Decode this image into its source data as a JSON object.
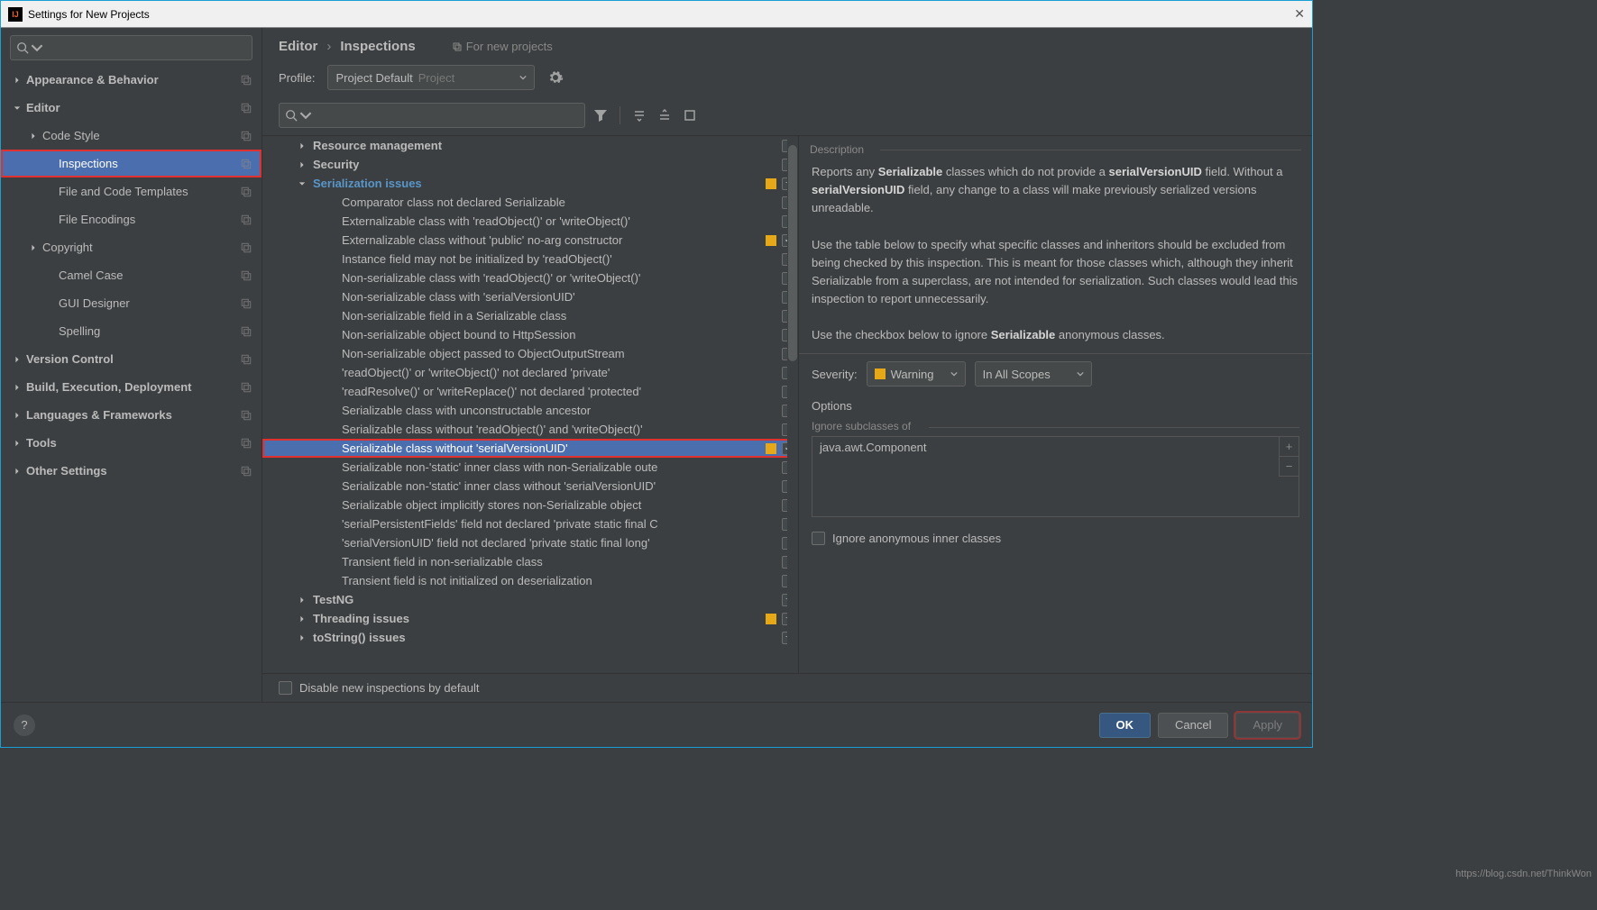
{
  "window": {
    "title": "Settings for New Projects"
  },
  "breadcrumb": {
    "a": "Editor",
    "b": "Inspections",
    "tag": "For new projects"
  },
  "profile": {
    "label": "Profile:",
    "value": "Project Default",
    "scope": "Project"
  },
  "sidebar": {
    "items": [
      {
        "label": "Appearance & Behavior",
        "arrow": "right",
        "indent": 0,
        "bold": true
      },
      {
        "label": "Editor",
        "arrow": "down",
        "indent": 0,
        "bold": true
      },
      {
        "label": "Code Style",
        "arrow": "right",
        "indent": 1,
        "bold": false
      },
      {
        "label": "Inspections",
        "arrow": "",
        "indent": 2,
        "bold": false,
        "selected": true,
        "highlight": true
      },
      {
        "label": "File and Code Templates",
        "arrow": "",
        "indent": 2,
        "bold": false
      },
      {
        "label": "File Encodings",
        "arrow": "",
        "indent": 2,
        "bold": false
      },
      {
        "label": "Copyright",
        "arrow": "right",
        "indent": 1,
        "bold": false
      },
      {
        "label": "Camel Case",
        "arrow": "",
        "indent": 2,
        "bold": false
      },
      {
        "label": "GUI Designer",
        "arrow": "",
        "indent": 2,
        "bold": false
      },
      {
        "label": "Spelling",
        "arrow": "",
        "indent": 2,
        "bold": false
      },
      {
        "label": "Version Control",
        "arrow": "right",
        "indent": 0,
        "bold": true
      },
      {
        "label": "Build, Execution, Deployment",
        "arrow": "right",
        "indent": 0,
        "bold": true
      },
      {
        "label": "Languages & Frameworks",
        "arrow": "right",
        "indent": 0,
        "bold": true
      },
      {
        "label": "Tools",
        "arrow": "right",
        "indent": 0,
        "bold": true
      },
      {
        "label": "Other Settings",
        "arrow": "right",
        "indent": 0,
        "bold": true
      }
    ]
  },
  "inspections": [
    {
      "type": "group",
      "label": "Resource management",
      "arrow": "right",
      "chk": "empty"
    },
    {
      "type": "group",
      "label": "Security",
      "arrow": "right",
      "chk": "empty"
    },
    {
      "type": "group",
      "label": "Serialization issues",
      "arrow": "down",
      "chk": "mixed",
      "badge": true,
      "link": true
    },
    {
      "type": "child",
      "label": "Comparator class not declared Serializable",
      "chk": "empty"
    },
    {
      "type": "child",
      "label": "Externalizable class with 'readObject()' or 'writeObject()'",
      "chk": "empty"
    },
    {
      "type": "child",
      "label": "Externalizable class without 'public' no-arg constructor",
      "chk": "checked",
      "badge": true
    },
    {
      "type": "child",
      "label": "Instance field may not be initialized by 'readObject()'",
      "chk": "empty"
    },
    {
      "type": "child",
      "label": "Non-serializable class with 'readObject()' or 'writeObject()'",
      "chk": "empty"
    },
    {
      "type": "child",
      "label": "Non-serializable class with 'serialVersionUID'",
      "chk": "empty"
    },
    {
      "type": "child",
      "label": "Non-serializable field in a Serializable class",
      "chk": "empty"
    },
    {
      "type": "child",
      "label": "Non-serializable object bound to HttpSession",
      "chk": "empty"
    },
    {
      "type": "child",
      "label": "Non-serializable object passed to ObjectOutputStream",
      "chk": "empty"
    },
    {
      "type": "child",
      "label": "'readObject()' or 'writeObject()' not declared 'private'",
      "chk": "empty"
    },
    {
      "type": "child",
      "label": "'readResolve()' or 'writeReplace()' not declared 'protected'",
      "chk": "empty"
    },
    {
      "type": "child",
      "label": "Serializable class with unconstructable ancestor",
      "chk": "empty"
    },
    {
      "type": "child",
      "label": "Serializable class without 'readObject()' and 'writeObject()'",
      "chk": "empty"
    },
    {
      "type": "child",
      "label": "Serializable class without 'serialVersionUID'",
      "chk": "checked",
      "badge": true,
      "selected": true,
      "highlight": true
    },
    {
      "type": "child",
      "label": "Serializable non-'static' inner class with non-Serializable oute",
      "chk": "empty"
    },
    {
      "type": "child",
      "label": "Serializable non-'static' inner class without 'serialVersionUID'",
      "chk": "empty"
    },
    {
      "type": "child",
      "label": "Serializable object implicitly stores non-Serializable object",
      "chk": "empty"
    },
    {
      "type": "child",
      "label": "'serialPersistentFields' field not declared 'private static final C",
      "chk": "empty"
    },
    {
      "type": "child",
      "label": "'serialVersionUID' field not declared 'private static final long'",
      "chk": "empty"
    },
    {
      "type": "child",
      "label": "Transient field in non-serializable class",
      "chk": "empty"
    },
    {
      "type": "child",
      "label": "Transient field is not initialized on deserialization",
      "chk": "empty"
    },
    {
      "type": "group",
      "label": "TestNG",
      "arrow": "right",
      "chk": "mixed"
    },
    {
      "type": "group",
      "label": "Threading issues",
      "arrow": "right",
      "chk": "mixed",
      "badge": true
    },
    {
      "type": "group",
      "label": "toString() issues",
      "arrow": "right",
      "chk": "mixed"
    }
  ],
  "disable_new": "Disable new inspections by default",
  "description": {
    "title": "Description",
    "p1a": "Reports any ",
    "p1b": "Serializable",
    "p1c": " classes which do not provide a ",
    "p1d": "serialVersionUID",
    "p1e": " field. Without a ",
    "p1f": "serialVersionUID",
    "p1g": " field, any change to a class will make previously serialized versions unreadable.",
    "p2": "Use the table below to specify what specific classes and inheritors should be excluded from being checked by this inspection. This is meant for those classes which, although they inherit Serializable from a superclass, are not intended for serialization. Such classes would lead this inspection to report unnecessarily.",
    "p3a": "Use the checkbox below to ignore ",
    "p3b": "Serializable",
    "p3c": " anonymous classes."
  },
  "severity": {
    "label": "Severity:",
    "value": "Warning",
    "scope": "In All Scopes"
  },
  "options": {
    "title": "Options",
    "ignore_sub": "Ignore subclasses of",
    "list_item": "java.awt.Component",
    "ignore_anon": "Ignore anonymous inner classes"
  },
  "buttons": {
    "ok": "OK",
    "cancel": "Cancel",
    "apply": "Apply"
  },
  "watermark": "https://blog.csdn.net/ThinkWon"
}
